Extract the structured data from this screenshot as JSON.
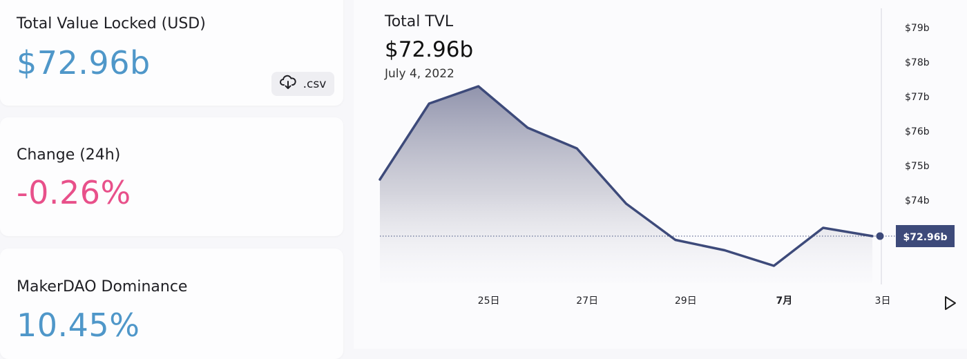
{
  "cards": {
    "tvl": {
      "label": "Total Value Locked (USD)",
      "value": "$72.96b",
      "csv_label": ".csv"
    },
    "change": {
      "label": "Change (24h)",
      "value": "-0.26%"
    },
    "dominance": {
      "label": "MakerDAO Dominance",
      "value": "10.45%"
    }
  },
  "header": {
    "title": "Total TVL",
    "value": "$72.96b",
    "date": "July 4, 2022"
  },
  "colors": {
    "accent_blue": "#4f97c9",
    "negative_pink": "#e8508a",
    "line": "#3d4a7a"
  },
  "icons": {
    "download": "cloud-download-icon",
    "play": "play-icon"
  },
  "chart_data": {
    "type": "area",
    "x": [
      "2022-06-23",
      "2022-06-24",
      "2022-06-25",
      "2022-06-26",
      "2022-06-27",
      "2022-06-28",
      "2022-06-29",
      "2022-06-30",
      "2022-07-01",
      "2022-07-02",
      "2022-07-03",
      "2022-07-04"
    ],
    "x_tick_labels": [
      {
        "x": "2022-06-25",
        "label": "25日",
        "bold": false
      },
      {
        "x": "2022-06-27",
        "label": "27日",
        "bold": false
      },
      {
        "x": "2022-06-29",
        "label": "29日",
        "bold": false
      },
      {
        "x": "2022-07-01",
        "label": "7月",
        "bold": true
      },
      {
        "x": "2022-07-03",
        "label": "3日",
        "bold": false
      }
    ],
    "y_ticks": [
      "$79b",
      "$78b",
      "$77b",
      "$76b",
      "$75b",
      "$74b"
    ],
    "y_tick_values": [
      79,
      78,
      77,
      76,
      75,
      74
    ],
    "series": [
      {
        "values": [
          74.6,
          76.8,
          77.3,
          76.1,
          75.5,
          73.9,
          72.85,
          72.55,
          72.1,
          73.2,
          72.96
        ]
      }
    ],
    "current_label": "$72.96b",
    "current_value": 72.96,
    "ylim": [
      71.6,
      79.4
    ]
  }
}
